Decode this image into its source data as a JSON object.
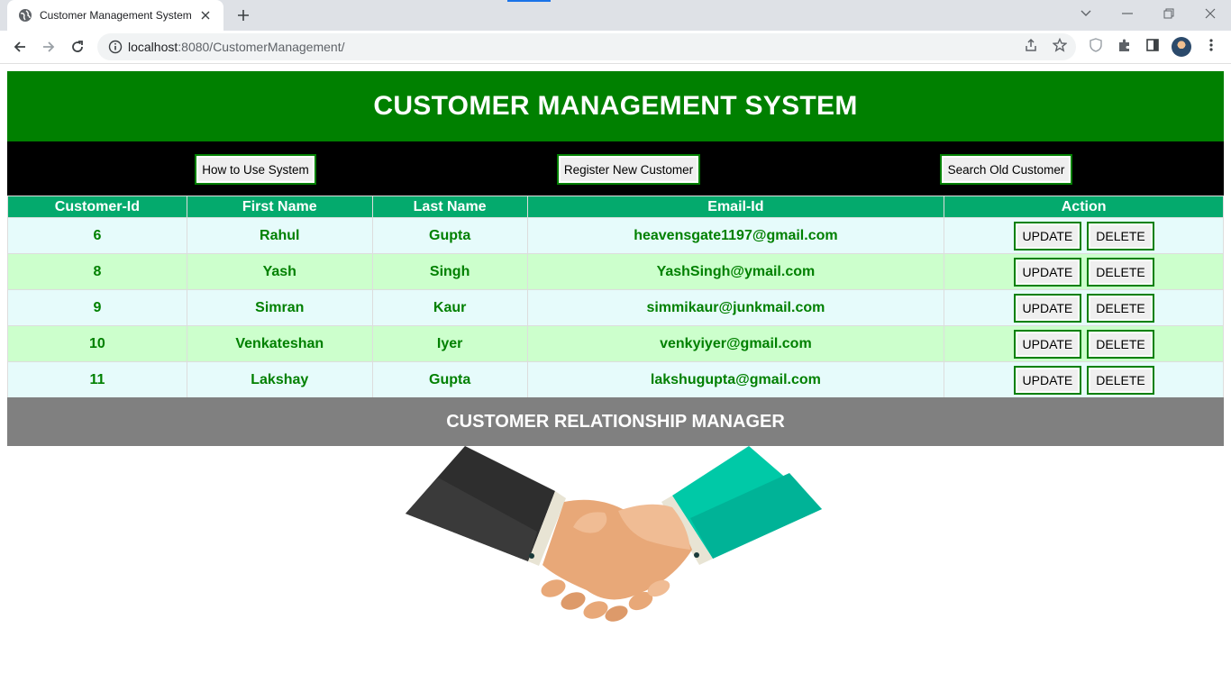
{
  "browser": {
    "tab_title": "Customer Management System",
    "url_host": "localhost",
    "url_path": ":8080/CustomerManagement/"
  },
  "page": {
    "header_title": "CUSTOMER MANAGEMENT SYSTEM",
    "nav": {
      "how_to_use": "How to Use System",
      "register": "Register New Customer",
      "search": "Search Old Customer"
    },
    "table": {
      "headers": [
        "Customer-Id",
        "First Name",
        "Last Name",
        "Email-Id",
        "Action"
      ],
      "rows": [
        {
          "id": "6",
          "first": "Rahul",
          "last": "Gupta",
          "email": "heavensgate1197@gmail.com"
        },
        {
          "id": "8",
          "first": "Yash",
          "last": "Singh",
          "email": "YashSingh@ymail.com"
        },
        {
          "id": "9",
          "first": "Simran",
          "last": "Kaur",
          "email": "simmikaur@junkmail.com"
        },
        {
          "id": "10",
          "first": "Venkateshan",
          "last": "Iyer",
          "email": "venkyiyer@gmail.com"
        },
        {
          "id": "11",
          "first": "Lakshay",
          "last": "Gupta",
          "email": "lakshugupta@gmail.com"
        }
      ],
      "update_label": "UPDATE",
      "delete_label": "DELETE"
    },
    "footer_title": "CUSTOMER RELATIONSHIP MANAGER"
  },
  "colors": {
    "header_green": "#008000",
    "table_header": "#04aa6d",
    "row_odd": "#e6fbfb",
    "row_even": "#ccffcc",
    "footer_gray": "#808080"
  },
  "icons": {
    "favicon": "globe-icon",
    "image": "handshake-illustration"
  }
}
